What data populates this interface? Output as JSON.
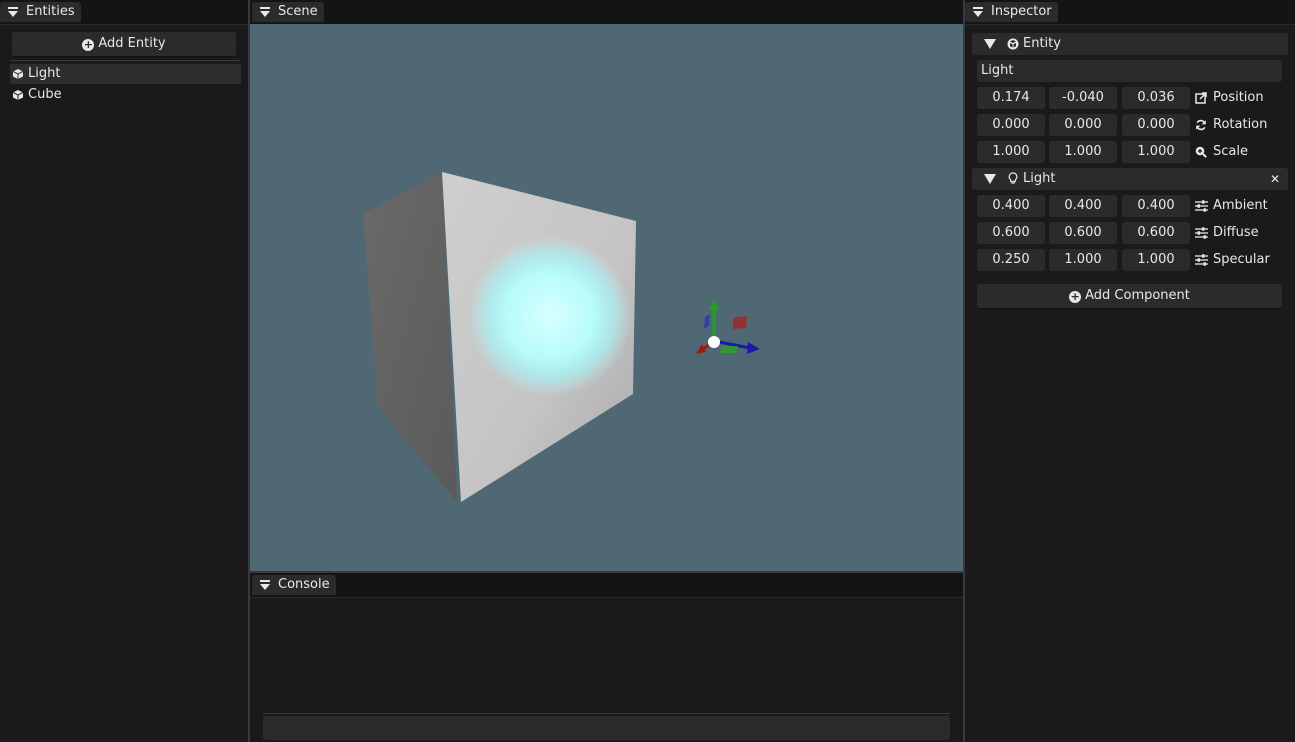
{
  "entities_panel": {
    "tab_label": "Entities",
    "add_button_label": "Add Entity",
    "items": [
      {
        "label": "Light",
        "selected": true
      },
      {
        "label": "Cube",
        "selected": false
      }
    ]
  },
  "scene_panel": {
    "tab_label": "Scene",
    "background_color": "#506874"
  },
  "console_panel": {
    "tab_label": "Console",
    "input_value": ""
  },
  "inspector_panel": {
    "tab_label": "Inspector",
    "entity_section": {
      "title": "Entity",
      "name_value": "Light",
      "rows": [
        {
          "label": "Position",
          "icon": "external-link-icon",
          "values": [
            "0.174",
            "-0.040",
            "0.036"
          ]
        },
        {
          "label": "Rotation",
          "icon": "refresh-icon",
          "values": [
            "0.000",
            "0.000",
            "0.000"
          ]
        },
        {
          "label": "Scale",
          "icon": "zoom-icon",
          "values": [
            "1.000",
            "1.000",
            "1.000"
          ]
        }
      ]
    },
    "light_section": {
      "title": "Light",
      "close_symbol": "✕",
      "rows": [
        {
          "label": "Ambient",
          "icon": "sliders-icon",
          "values": [
            "0.400",
            "0.400",
            "0.400"
          ]
        },
        {
          "label": "Diffuse",
          "icon": "sliders-icon",
          "values": [
            "0.600",
            "0.600",
            "0.600"
          ]
        },
        {
          "label": "Specular",
          "icon": "sliders-icon",
          "values": [
            "0.250",
            "1.000",
            "1.000"
          ]
        }
      ]
    },
    "add_component_label": "Add Component"
  }
}
